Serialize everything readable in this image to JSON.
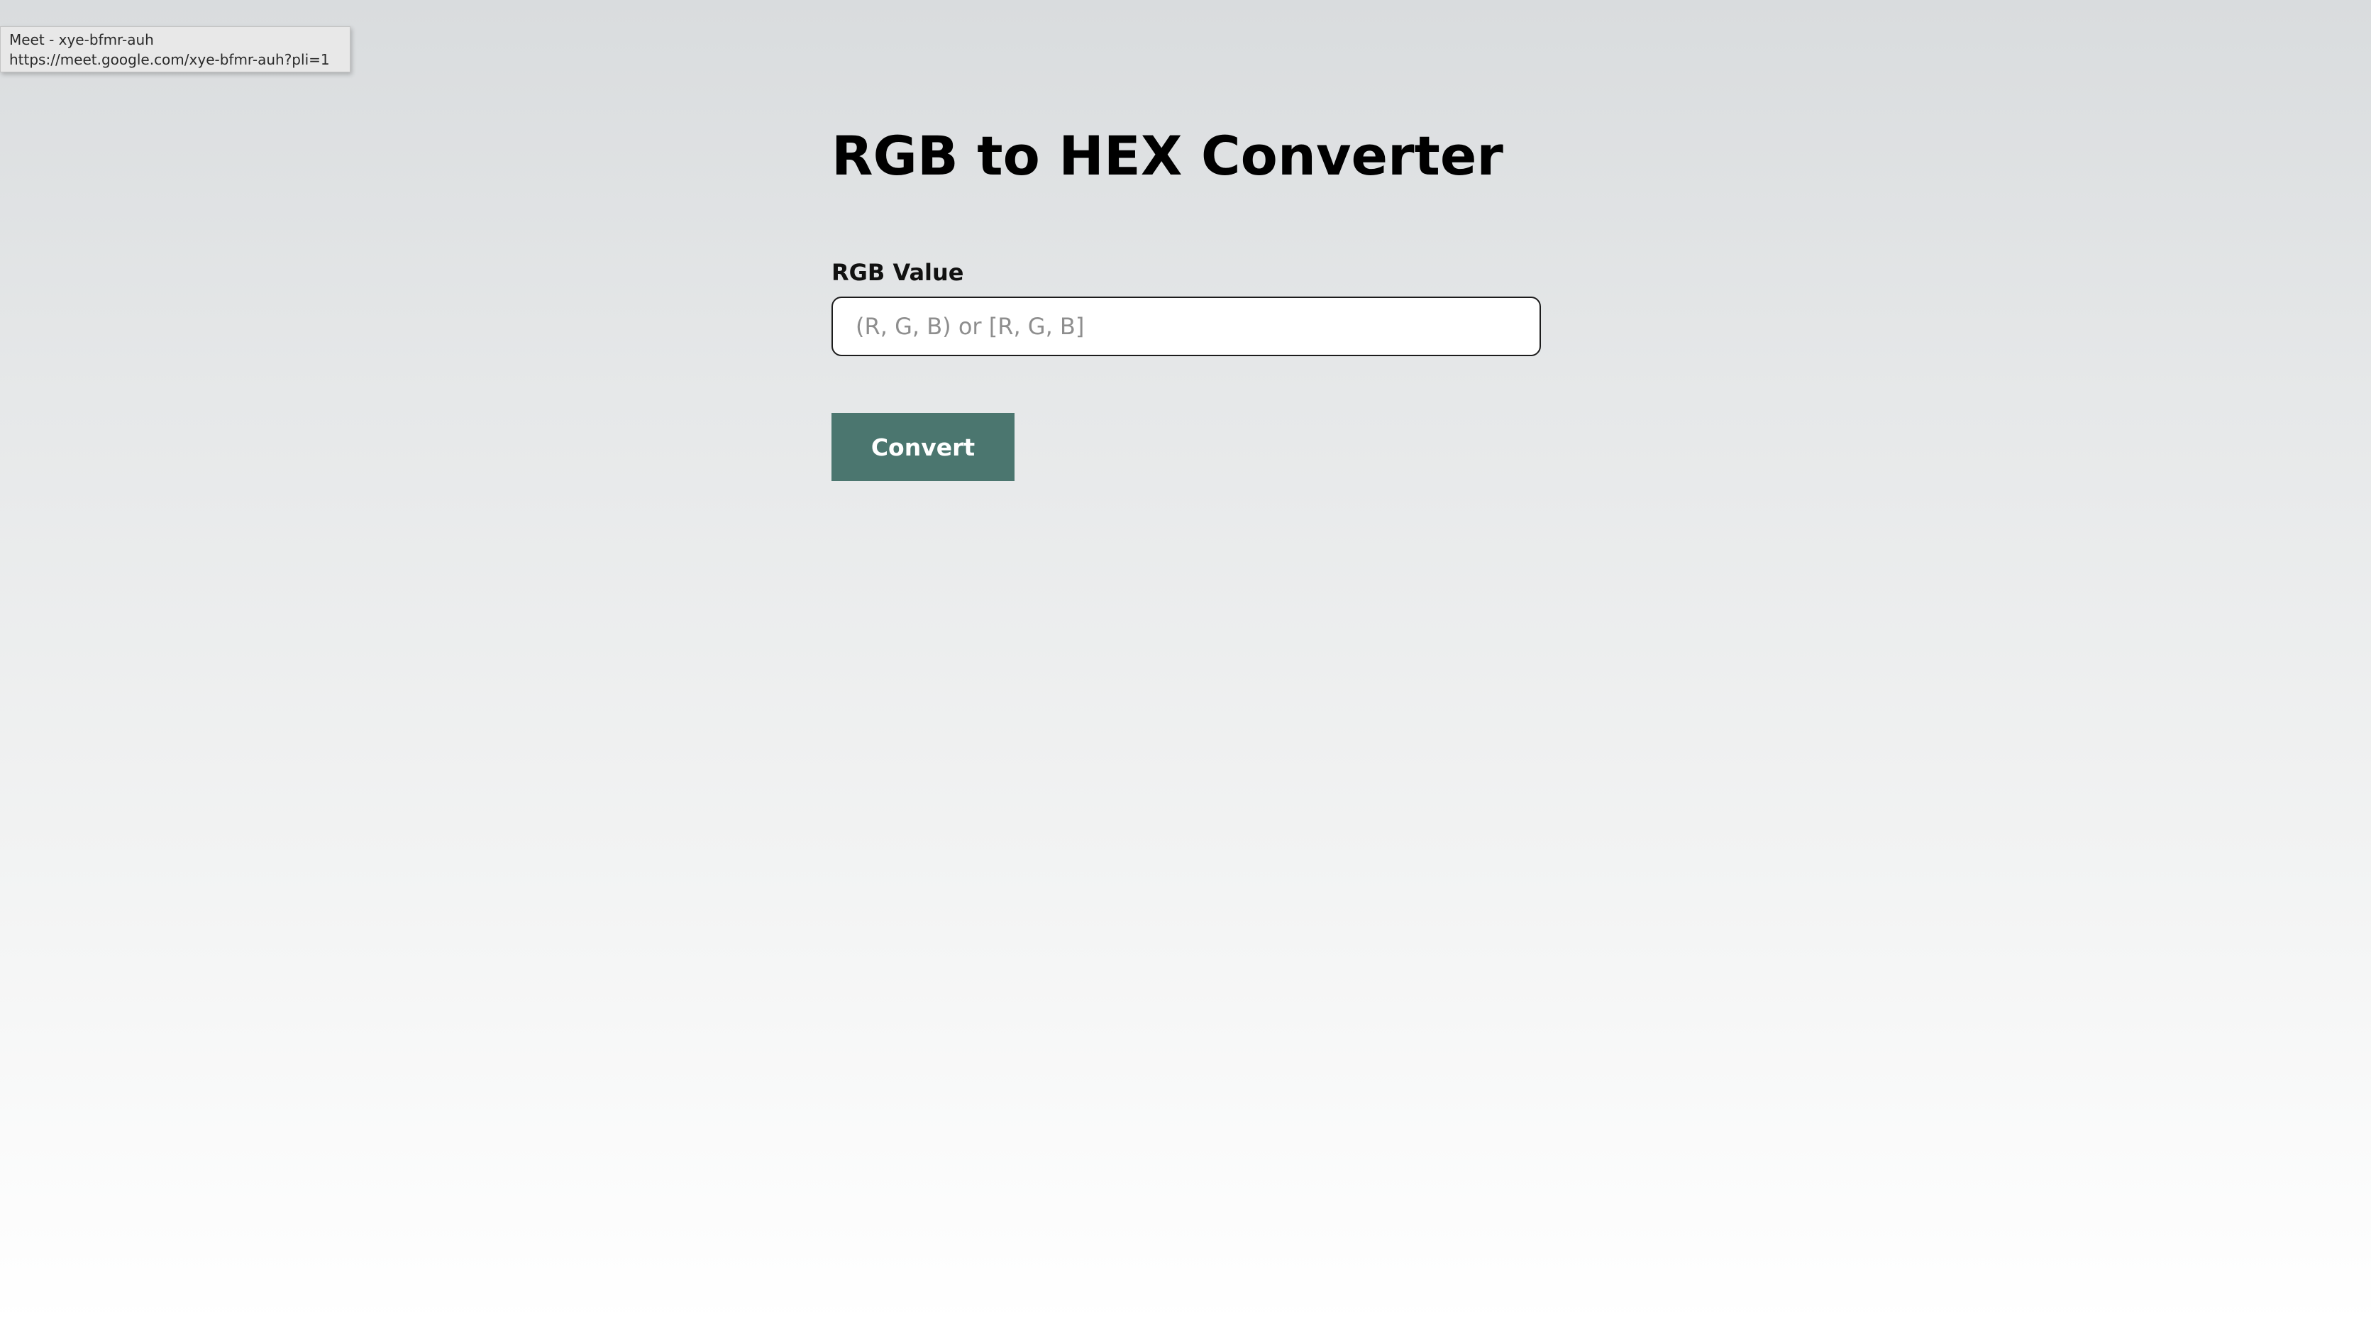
{
  "tooltip": {
    "title": "Meet - xye-bfmr-auh",
    "url": "https://meet.google.com/xye-bfmr-auh?pli=1"
  },
  "page": {
    "title": "RGB to HEX Converter"
  },
  "form": {
    "rgb_label": "RGB Value",
    "rgb_input_value": "",
    "rgb_input_placeholder": "(R, G, B) or [R, G, B]",
    "convert_label": "Convert"
  },
  "colors": {
    "button_background": "#4b766f",
    "button_text": "#ffffff",
    "title_text": "#000000",
    "input_border": "#1c1c1c",
    "placeholder_text": "#8e8e8e"
  }
}
